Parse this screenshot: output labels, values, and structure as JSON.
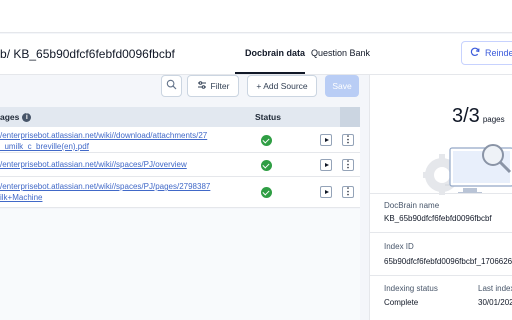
{
  "header": {
    "breadcrumb_prefix": "b",
    "breadcrumb_sep": "/",
    "breadcrumb_current": "KB_65b90dfcf6febfd0096fbcbf",
    "tabs": [
      {
        "label": "Docbrain data",
        "active": true
      },
      {
        "label": "Question Bank",
        "active": false
      }
    ],
    "reindex_label": "Reindex"
  },
  "toolbar": {
    "search_icon": "search-icon",
    "filter_label": "Filter",
    "add_source_label": "+ Add Source",
    "save_label": "Save"
  },
  "table": {
    "col_pages": "ages",
    "col_status": "Status",
    "rows": [
      {
        "line1": "/enterprisebot.atlassian.net/wiki//download/attachments/27",
        "line2": "_umilk_c_breville(en).pdf",
        "status": "complete"
      },
      {
        "line1": "/enterprisebot.atlassian.net/wiki//spaces/PJ/overview",
        "line2": "",
        "status": "complete"
      },
      {
        "line1": "/enterprisebot.atlassian.net/wiki//spaces/PJ/pages/2798387",
        "line2": "ilk+Machine",
        "status": "complete"
      }
    ]
  },
  "panel": {
    "count": "3/3",
    "count_unit": "pages",
    "docbrain_name_label": "DocBrain name",
    "docbrain_name_value": "KB_65b90dfcf6febfd0096fbcbf",
    "index_id_label": "Index ID",
    "index_id_value": "65b90dfcf6febfd0096fbcbf_1706626",
    "indexing_status_label": "Indexing status",
    "indexing_status_value": "Complete",
    "last_indexed_label": "Last index",
    "last_indexed_value": "30/01/202"
  },
  "colors": {
    "accent": "#3b5bdb",
    "link": "#4169c8",
    "success": "#2f9e44",
    "save_disabled": "#b9cdf5"
  }
}
